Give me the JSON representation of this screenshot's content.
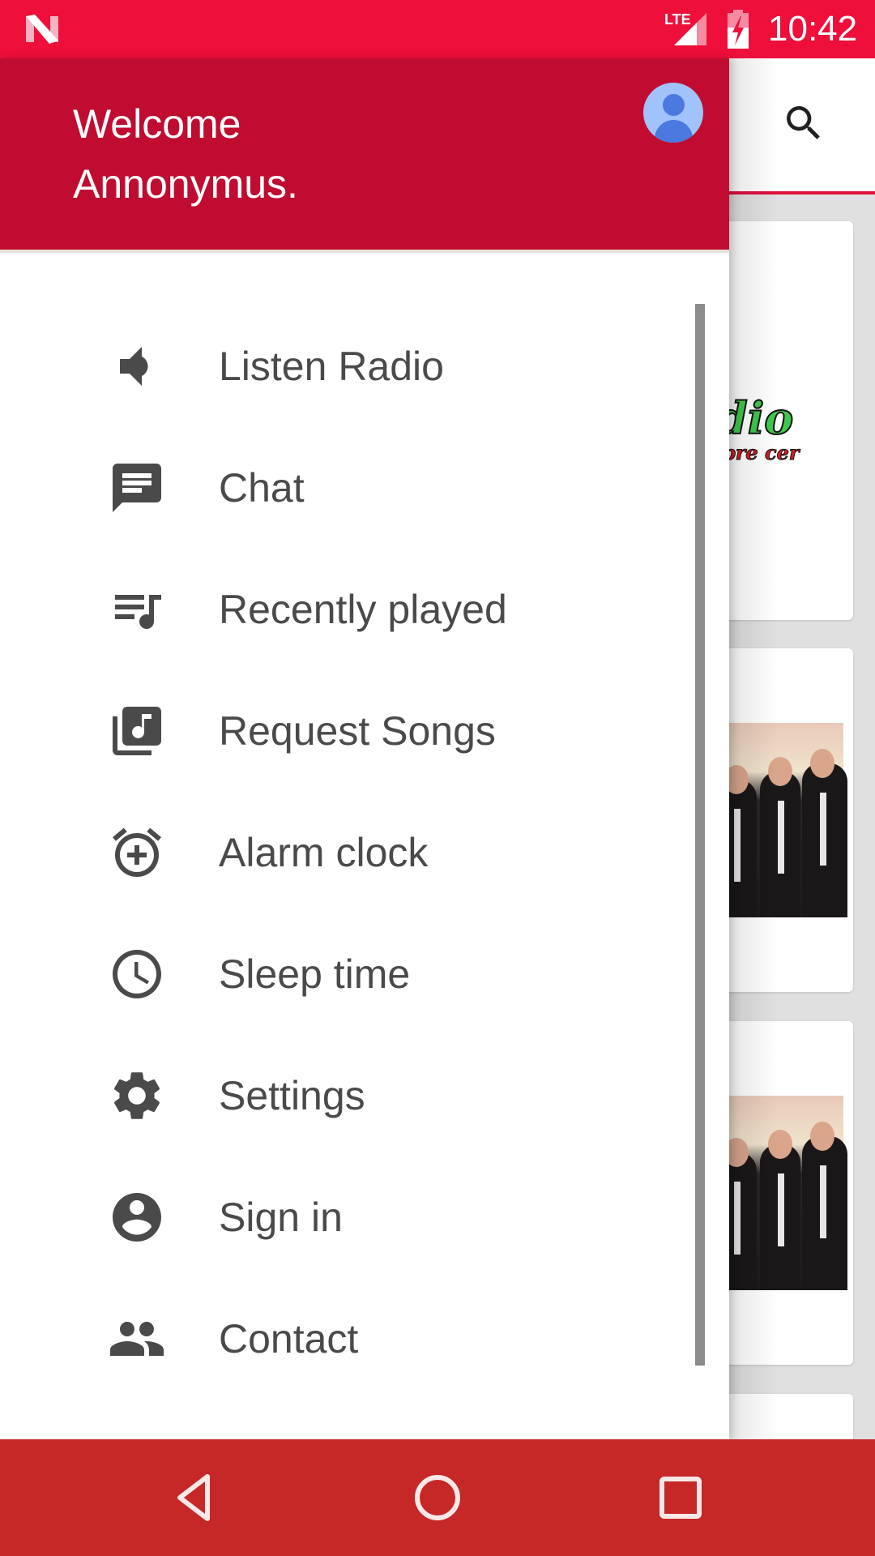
{
  "status_bar": {
    "notification_icon": "n-logo-icon",
    "network": "LTE",
    "battery_icon": "battery-charging-icon",
    "time": "10:42"
  },
  "app_toolbar": {
    "search_icon": "search-icon"
  },
  "background_cards": [
    {
      "type": "logo",
      "logo_line1": "adio",
      "logo_line2": "i spre cer"
    },
    {
      "type": "photo",
      "alt": "three men singing with microphones"
    },
    {
      "type": "photo",
      "alt": "three men singing with microphones"
    },
    {
      "type": "partial"
    }
  ],
  "drawer": {
    "header": {
      "welcome_line1": "Welcome",
      "welcome_line2": "Annonymus.",
      "avatar_icon": "account-avatar-icon",
      "background_color": "#c00c30"
    },
    "menu_items": [
      {
        "label": "Listen Radio",
        "icon": "volume-icon"
      },
      {
        "label": "Chat",
        "icon": "chat-icon"
      },
      {
        "label": "Recently played",
        "icon": "queue-music-icon"
      },
      {
        "label": "Request Songs",
        "icon": "library-music-icon"
      },
      {
        "label": "Alarm clock",
        "icon": "alarm-add-icon"
      },
      {
        "label": "Sleep time",
        "icon": "clock-icon"
      },
      {
        "label": "Settings",
        "icon": "gear-icon"
      },
      {
        "label": "Sign in",
        "icon": "account-circle-icon"
      },
      {
        "label": "Contact",
        "icon": "people-icon"
      }
    ]
  },
  "nav_bar": {
    "back": "back-icon",
    "home": "home-icon",
    "recents": "recents-icon",
    "background_color": "#c62828"
  },
  "colors": {
    "status_bar": "#ee0f3a",
    "accent": "#e0103c",
    "menu_text": "#4a4a4a",
    "icon": "#4a4a4a"
  }
}
